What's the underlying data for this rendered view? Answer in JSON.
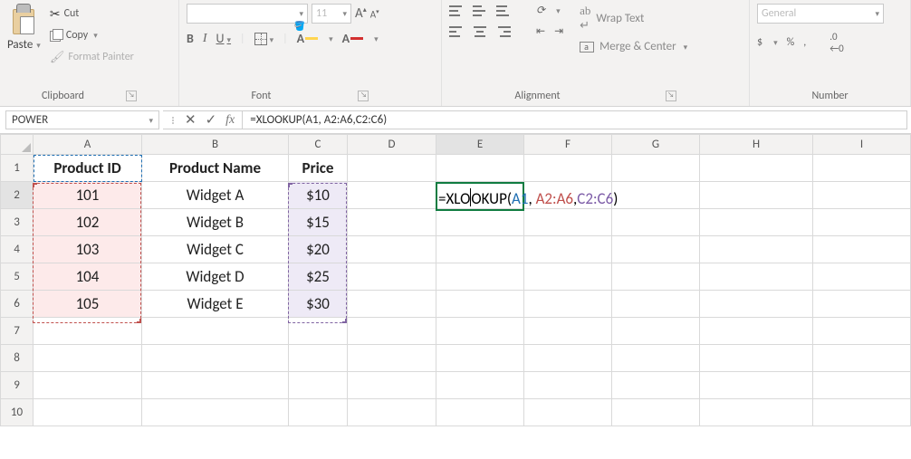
{
  "ribbon": {
    "clipboard": {
      "paste_label": "Paste",
      "cut_label": "Cut",
      "copy_label": "Copy",
      "format_painter_label": "Format Painter",
      "group_label": "Clipboard"
    },
    "font": {
      "font_name_placeholder": "",
      "font_size": "11",
      "bold": "B",
      "italic": "I",
      "underline": "U",
      "group_label": "Font"
    },
    "alignment": {
      "wrap_text_label": "Wrap Text",
      "merge_center_label": "Merge & Center",
      "group_label": "Alignment"
    },
    "number": {
      "format_placeholder": "General",
      "percent": "%",
      "comma": ",",
      "group_label": "Number"
    }
  },
  "formula_bar": {
    "name_box": "POWER",
    "fx_label": "fx",
    "formula_text": "=XLOOKUP(A1, A2:A6,C2:C6)"
  },
  "columns": [
    "A",
    "B",
    "C",
    "D",
    "E",
    "F",
    "G",
    "H",
    "I"
  ],
  "row_numbers": [
    "1",
    "2",
    "3",
    "4",
    "5",
    "6",
    "7",
    "8",
    "9",
    "10"
  ],
  "table": {
    "headers": {
      "A": "Product ID",
      "B": "Product Name",
      "C": "Price"
    },
    "rows": [
      {
        "A": "101",
        "B": "Widget A",
        "C": "$10"
      },
      {
        "A": "102",
        "B": "Widget B",
        "C": "$15"
      },
      {
        "A": "103",
        "B": "Widget C",
        "C": "$20"
      },
      {
        "A": "104",
        "B": "Widget D",
        "C": "$25"
      },
      {
        "A": "105",
        "B": "Widget E",
        "C": "$30"
      }
    ]
  },
  "editing_cell": {
    "prefix": "=XLO",
    "after_cursor": "OKUP(",
    "arg1": "A1",
    "sep1": ", ",
    "arg2": "A2:A6",
    "sep2": ",",
    "arg3": "C2:C6",
    "suffix": ")"
  }
}
